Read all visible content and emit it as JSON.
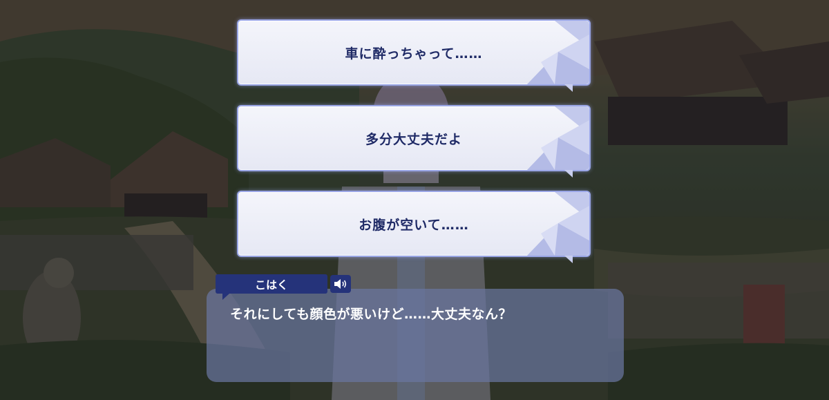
{
  "choices": [
    {
      "label": "車に酔っちゃって……"
    },
    {
      "label": "多分大丈夫だよ"
    },
    {
      "label": "お腹が空いて……"
    }
  ],
  "dialogue": {
    "speaker": "こはく",
    "text": "それにしても顔色が悪いけど……大丈夫なん？",
    "voice_icon": "speaker-icon"
  },
  "colors": {
    "choice_text": "#1f2a66",
    "choice_border": "#9aa6e6",
    "name_tag": "#25337a",
    "dialog_bg": "#6976a0"
  }
}
